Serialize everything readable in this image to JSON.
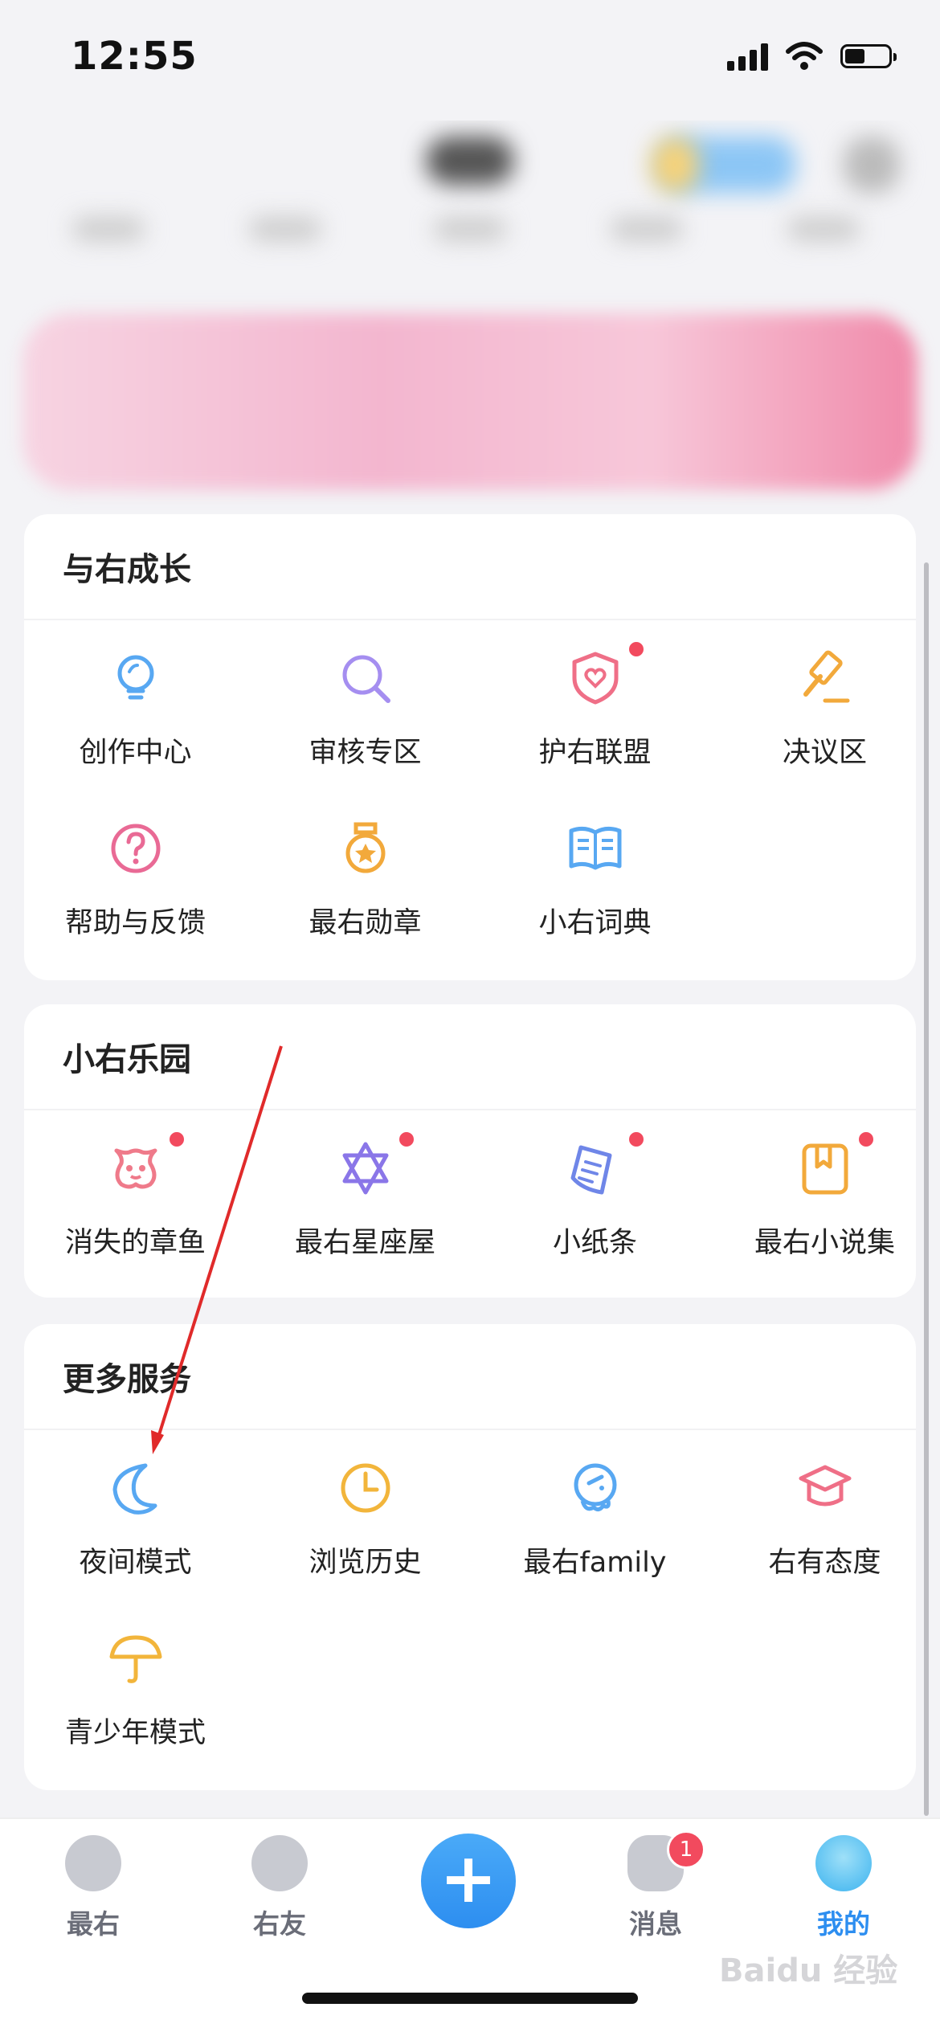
{
  "status_bar": {
    "time": "12:55"
  },
  "section_growth": {
    "title": "与右成长",
    "items": [
      {
        "label": "创作中心",
        "icon": "lightbulb-icon"
      },
      {
        "label": "审核专区",
        "icon": "magnifier-icon"
      },
      {
        "label": "护右联盟",
        "icon": "shield-heart-icon"
      },
      {
        "label": "决议区",
        "icon": "gavel-icon"
      },
      {
        "label": "帮助与反馈",
        "icon": "help-icon"
      },
      {
        "label": "最右勋章",
        "icon": "medal-icon"
      },
      {
        "label": "小右词典",
        "icon": "book-icon"
      }
    ]
  },
  "section_park": {
    "title": "小右乐园",
    "items": [
      {
        "label": "消失的章鱼",
        "icon": "octopus-icon"
      },
      {
        "label": "最右星座屋",
        "icon": "star-icon"
      },
      {
        "label": "小纸条",
        "icon": "note-icon"
      },
      {
        "label": "最右小说集",
        "icon": "novel-icon"
      }
    ]
  },
  "section_more": {
    "title": "更多服务",
    "items": [
      {
        "label": "夜间模式",
        "icon": "moon-icon"
      },
      {
        "label": "浏览历史",
        "icon": "clock-icon"
      },
      {
        "label": "最右family",
        "icon": "family-icon"
      },
      {
        "label": "右有态度",
        "icon": "graduation-cap-icon"
      },
      {
        "label": "青少年模式",
        "icon": "umbrella-icon"
      }
    ]
  },
  "tabbar": {
    "tabs": [
      {
        "label": "最右"
      },
      {
        "label": "右友"
      },
      {
        "label": "消息",
        "badge": "1"
      },
      {
        "label": "我的"
      }
    ],
    "plus_label": "+"
  },
  "watermark": "Baidu 经验",
  "colors": {
    "accent": "#2d8ef0",
    "badge": "#f24a5e",
    "background": "#f3f3f6"
  }
}
